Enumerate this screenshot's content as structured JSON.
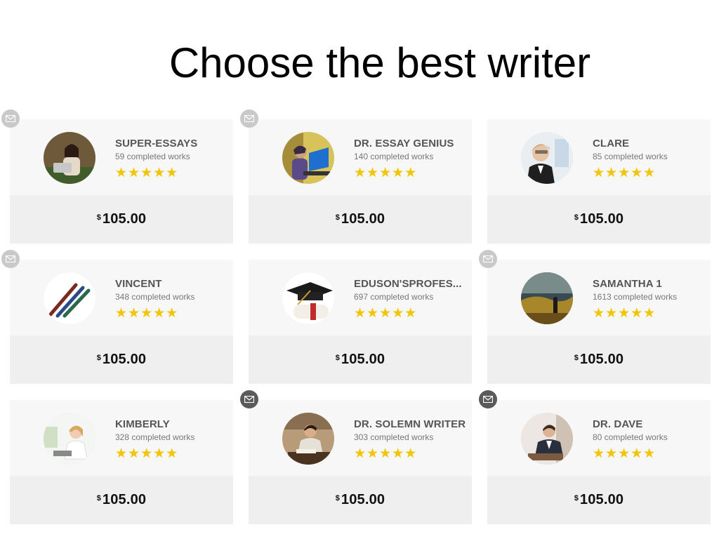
{
  "page": {
    "title": "Choose the best writer"
  },
  "writers": [
    {
      "name": "SUPER-ESSAYS",
      "works": "59 completed works",
      "rating": 4.5,
      "price_currency": "$",
      "price": "105.00",
      "mail_active": false
    },
    {
      "name": "DR. ESSAY GENIUS",
      "works": "140 completed works",
      "rating": 5,
      "price_currency": "$",
      "price": "105.00",
      "mail_active": false
    },
    {
      "name": "CLARE",
      "works": "85 completed works",
      "rating": 4.5,
      "price_currency": "$",
      "price": "105.00",
      "mail_active": false
    },
    {
      "name": "VINCENT",
      "works": "348 completed works",
      "rating": 4.5,
      "price_currency": "$",
      "price": "105.00",
      "mail_active": false
    },
    {
      "name": "EDUSON'SPROFES...",
      "works": "697 completed works",
      "rating": 5,
      "price_currency": "$",
      "price": "105.00",
      "mail_active": false
    },
    {
      "name": "SAMANTHA 1",
      "works": "1613 completed works",
      "rating": 5,
      "price_currency": "$",
      "price": "105.00",
      "mail_active": false
    },
    {
      "name": "KIMBERLY",
      "works": "328 completed works",
      "rating": 5,
      "price_currency": "$",
      "price": "105.00",
      "mail_active": false
    },
    {
      "name": "DR. SOLEMN WRITER",
      "works": "303 completed works",
      "rating": 5,
      "price_currency": "$",
      "price": "105.00",
      "mail_active": true
    },
    {
      "name": "DR. DAVE",
      "works": "80 completed works",
      "rating": 5,
      "price_currency": "$",
      "price": "105.00",
      "mail_active": true
    }
  ],
  "colors": {
    "star": "#f2c500",
    "star_empty": "#e3e3e3",
    "card_top": "#f7f7f7",
    "card_bottom": "#efefef"
  }
}
